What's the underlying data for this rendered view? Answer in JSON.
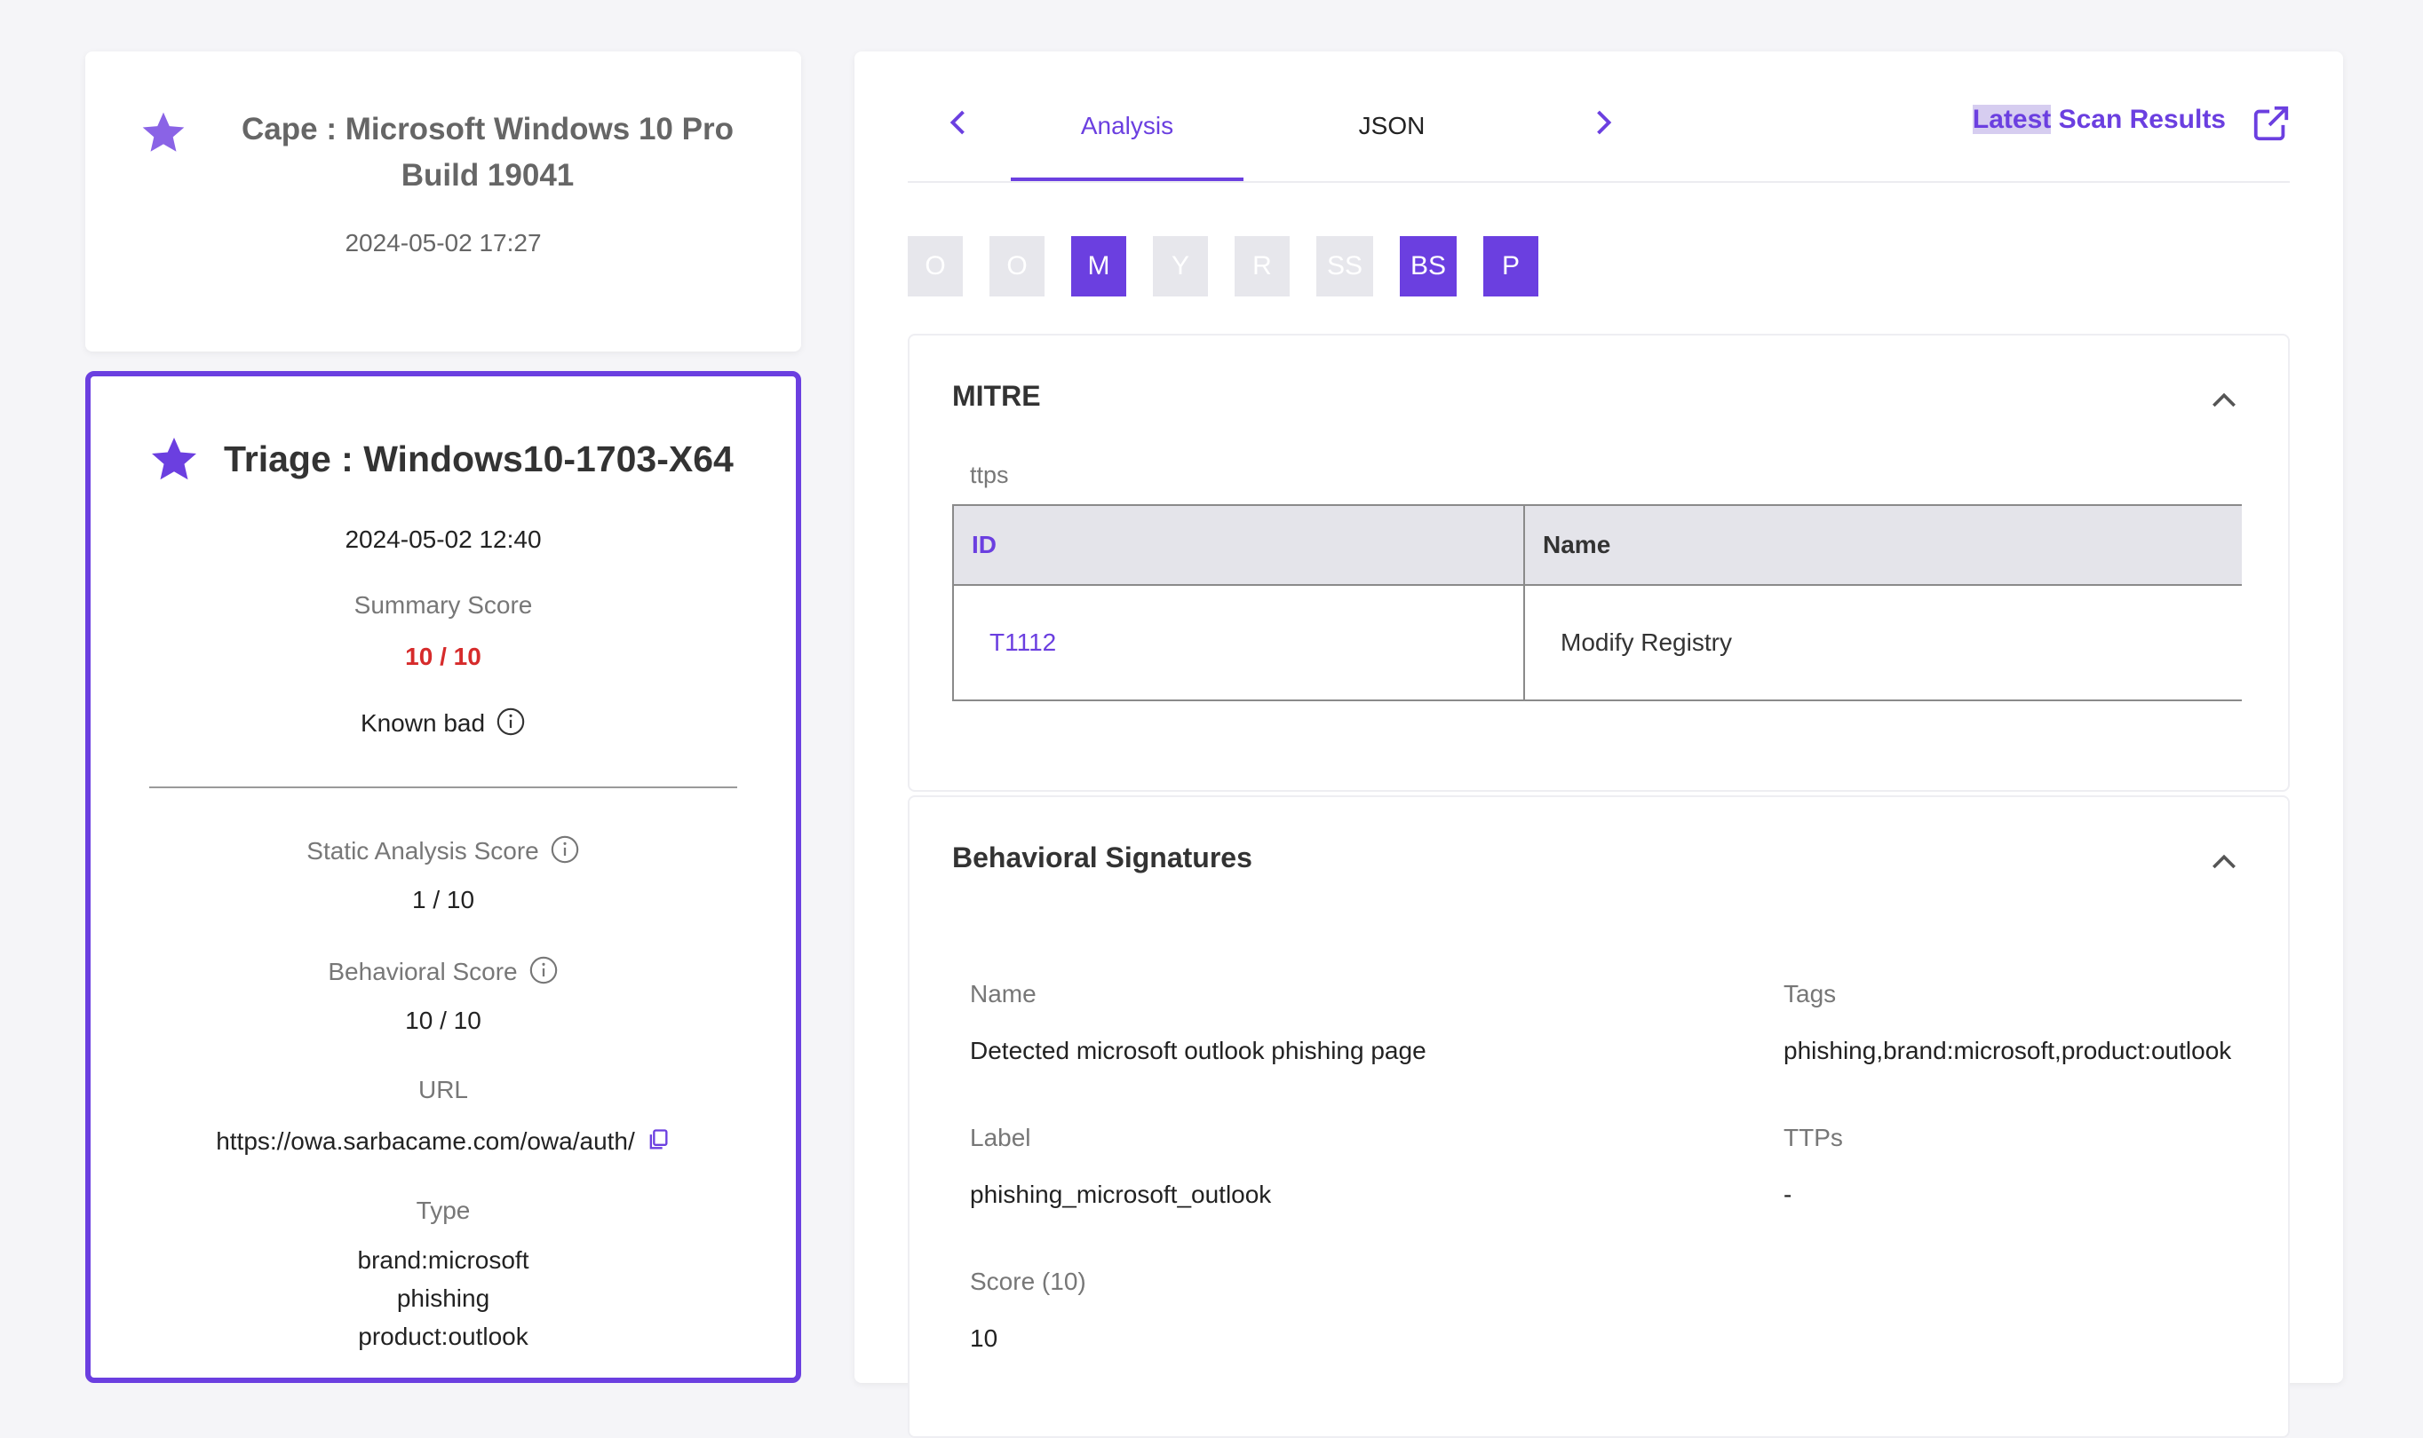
{
  "cape": {
    "title": "Cape : Microsoft Windows 10 Pro Build 19041",
    "date": "2024-05-02 17:27"
  },
  "triage": {
    "title": "Triage : Windows10-1703-X64",
    "date": "2024-05-02 12:40",
    "summary_label": "Summary Score",
    "summary_value": "10 / 10",
    "verdict": "Known bad",
    "static_label": "Static Analysis Score",
    "static_value": "1 / 10",
    "behavioral_label": "Behavioral Score",
    "behavioral_value": "10 / 10",
    "url_label": "URL",
    "url_value": "https://owa.sarbacame.com/owa/auth/",
    "type_label": "Type",
    "type_values": [
      "brand:microsoft",
      "phishing",
      "product:outlook"
    ]
  },
  "tabs": {
    "analysis": "Analysis",
    "json": "JSON"
  },
  "latest_link": {
    "highlight": "Latest",
    "rest": " Scan Results"
  },
  "chips": [
    "O",
    "O",
    "M",
    "Y",
    "R",
    "SS",
    "BS",
    "P"
  ],
  "chip_active": [
    false,
    false,
    true,
    false,
    false,
    false,
    true,
    true
  ],
  "mitre": {
    "title": "MITRE",
    "sub_label": "ttps",
    "headers": [
      "ID",
      "Name"
    ],
    "rows": [
      [
        "T1112",
        "Modify Registry"
      ]
    ]
  },
  "signatures": {
    "title": "Behavioral Signatures",
    "name_label": "Name",
    "name_value": "Detected microsoft outlook phishing page",
    "tags_label": "Tags",
    "tags_value": "phishing,brand:microsoft,product:outlook",
    "label_label": "Label",
    "label_value": "phishing_microsoft_outlook",
    "ttps_label": "TTPs",
    "ttps_value": "-",
    "score_label": "Score (10)",
    "score_value": "10"
  },
  "colors": {
    "accent": "#6b3fe0",
    "danger": "#d62b2b",
    "chip_off": "#e7e7ec"
  }
}
